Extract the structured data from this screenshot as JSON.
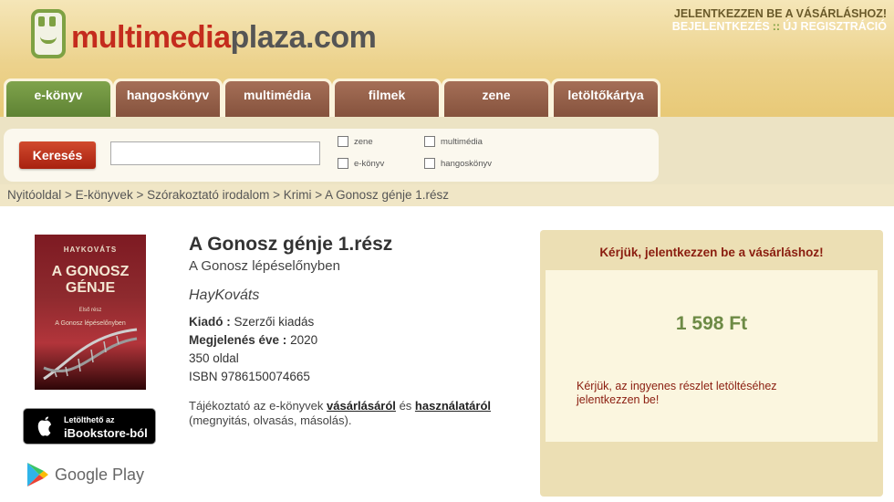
{
  "site": {
    "logo_part1": "multimedia",
    "logo_part2": "plaza.com"
  },
  "account": {
    "prompt": "JELENTKEZZEN BE A VÁSÁRLÁSHOZ!",
    "login": "BEJELENTKEZÉS",
    "separator": "::",
    "register": "ÚJ REGISZTRÁCIÓ"
  },
  "tabs": [
    {
      "label": "e-könyv",
      "active": true
    },
    {
      "label": "hangoskönyv",
      "active": false
    },
    {
      "label": "multimédia",
      "active": false
    },
    {
      "label": "filmek",
      "active": false
    },
    {
      "label": "zene",
      "active": false
    },
    {
      "label": "letöltőkártya",
      "active": false
    }
  ],
  "search": {
    "button_label": "Keresés",
    "input_value": "",
    "filters": [
      {
        "label": "zene",
        "checked": false
      },
      {
        "label": "multimédia",
        "checked": false
      },
      {
        "label": "e-könyv",
        "checked": false
      },
      {
        "label": "hangoskönyv",
        "checked": false
      }
    ]
  },
  "breadcrumb": "Nyitóoldal > E-könyvek > Szórakoztató irodalom > Krimi > A Gonosz génje 1.rész",
  "cover": {
    "author": "HAYKOVÁTS",
    "title_line1": "A GONOSZ",
    "title_line2": "GÉNJE",
    "part": "Első rész",
    "subtitle": "A Gonosz lépéselőnyben"
  },
  "badges": {
    "apple_line1": "Letölthető az",
    "apple_line2": "iBookstore-ból",
    "google": "Google Play"
  },
  "book": {
    "title": "A Gonosz génje 1.rész",
    "subtitle": "A Gonosz lépéselőnyben",
    "author": "HayKováts",
    "publisher_label": "Kiadó :",
    "publisher": "Szerzői kiadás",
    "year_label": "Megjelenés éve :",
    "year": "2020",
    "pages": "350 oldal",
    "isbn": "ISBN 9786150074665"
  },
  "info": {
    "prefix": "Tájékoztató az e-könyvek",
    "link1": "vásárlásáról",
    "and": "és",
    "link2": "használatáról",
    "suffix": "(megnyitás, olvasás, másolás)."
  },
  "buy": {
    "login_prompt": "Kérjük, jelentkezzen be a vásárláshoz!",
    "price": "1 598 Ft",
    "sample_note": "Kérjük, az ingyenes részlet letöltéséhez jelentkezzen be!"
  },
  "colors": {
    "accent_red": "#c42b1d",
    "tab_active": "#7fa34c",
    "tab_inactive": "#9a6550",
    "price_green": "#6d8a45"
  }
}
